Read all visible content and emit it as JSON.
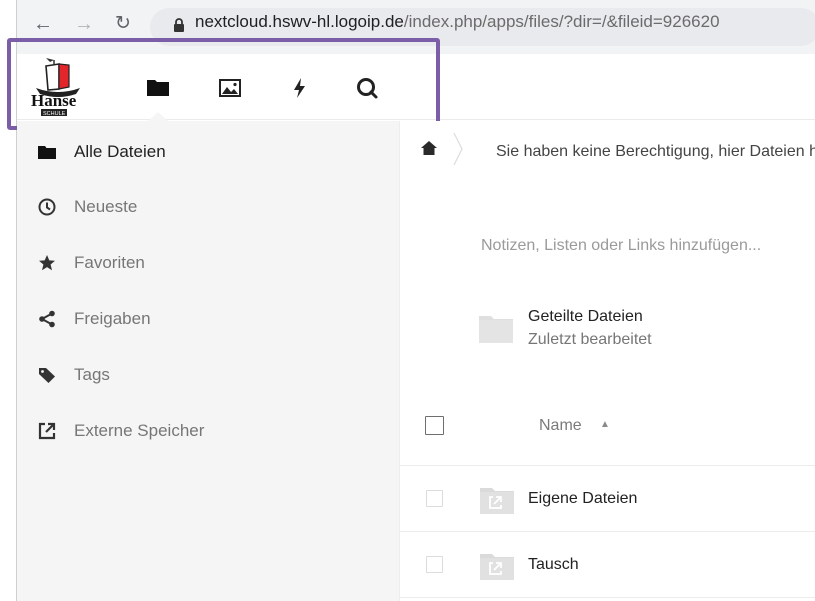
{
  "browser": {
    "back_icon": "arrow-left-icon",
    "forward_icon": "arrow-right-icon",
    "reload_icon": "reload-icon",
    "url_host": "nextcloud.hswv-hl.logoip.de",
    "url_path": "/index.php/apps/files/?dir=/&fileid=926620"
  },
  "header": {
    "logo": "hanse-schule-logo",
    "apps": [
      {
        "name": "Dateien",
        "icon": "folder-icon",
        "active": true
      },
      {
        "name": "Fotos",
        "icon": "image-icon",
        "active": false
      },
      {
        "name": "Aktivität",
        "icon": "lightning-icon",
        "active": false
      },
      {
        "name": "Suche",
        "icon": "search-icon",
        "active": false
      }
    ],
    "highlight_color": "#7b5ea7"
  },
  "sidebar": {
    "items": [
      {
        "label": "Alle Dateien",
        "icon": "folder-icon",
        "active": true
      },
      {
        "label": "Neueste",
        "icon": "clock-icon",
        "active": false
      },
      {
        "label": "Favoriten",
        "icon": "star-icon",
        "active": false
      },
      {
        "label": "Freigaben",
        "icon": "share-icon",
        "active": false
      },
      {
        "label": "Tags",
        "icon": "tag-icon",
        "active": false
      },
      {
        "label": "Externe Speicher",
        "icon": "external-link-icon",
        "active": false
      }
    ]
  },
  "main": {
    "breadcrumb_home_icon": "home-icon",
    "breadcrumb_text": "Sie haben keine Berechtigung, hier Dateien hochzuladen oder zu erstellen",
    "notes_placeholder": "Notizen, Listen oder Links hinzufügen...",
    "recent": {
      "name": "Geteilte Dateien",
      "subtitle": "Zuletzt bearbeitet"
    },
    "table": {
      "column_name": "Name",
      "sort_icon": "sort-ascending-icon",
      "rows": [
        {
          "name": "Eigene Dateien",
          "icon": "external-folder-icon"
        },
        {
          "name": "Tausch",
          "icon": "external-folder-icon"
        }
      ]
    }
  }
}
